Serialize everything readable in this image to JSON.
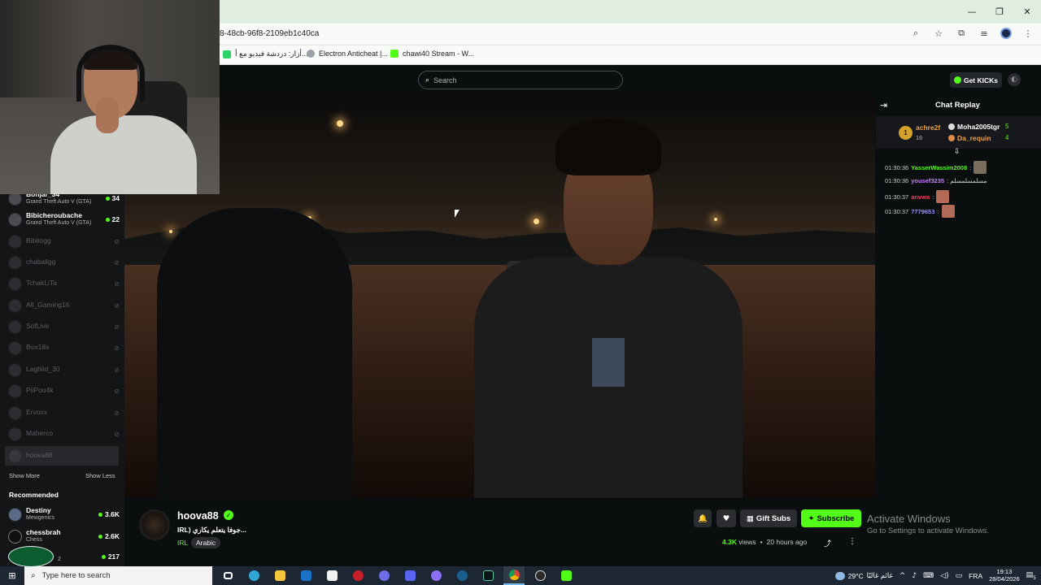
{
  "browser": {
    "url": "8-48cb-96f8-2109eb1c40ca",
    "window_controls": [
      "—",
      "❐",
      "✕"
    ],
    "bookmarks": [
      {
        "label": "أزار: دردشة فيديو مع أ...",
        "color": "#2bd46b"
      },
      {
        "label": "Electron Anticheat |...",
        "color": "#9aa0a6"
      },
      {
        "label": "chawi40 Stream - W...",
        "color": "#53fc18"
      }
    ]
  },
  "header": {
    "search_placeholder": "Search",
    "get_kicks_label": "Get KICKs"
  },
  "sidebar": {
    "following": [
      {
        "name": "Bonjar_34",
        "game": "Grand Theft Auto V (GTA)",
        "count": "34",
        "live": true
      },
      {
        "name": "Bibicheroubache",
        "game": "Grand Theft Auto V (GTA)",
        "count": "22",
        "live": true
      },
      {
        "name": "Bibitogg",
        "live": false
      },
      {
        "name": "chaballgg",
        "live": false
      },
      {
        "name": "TchakLiTa",
        "live": false
      },
      {
        "name": "All_Gaming16",
        "live": false
      },
      {
        "name": "SofLive",
        "live": false
      },
      {
        "name": "Box18x",
        "live": false
      },
      {
        "name": "Laghiid_30",
        "live": false
      },
      {
        "name": "PiiPou4k",
        "live": false
      },
      {
        "name": "Ervoxx",
        "live": false
      },
      {
        "name": "Maherco",
        "live": false
      },
      {
        "name": "hoova88",
        "live": false,
        "active": true
      }
    ],
    "show_more": "Show More",
    "show_less": "Show Less",
    "recommended_title": "Recommended",
    "recommended": [
      {
        "name": "Destiny",
        "game": "Mewgenics",
        "count": "3.6K"
      },
      {
        "name": "chessbrah",
        "game": "Chess",
        "count": "2.6K"
      },
      {
        "name": "",
        "game": "2",
        "count": "217"
      }
    ]
  },
  "chat": {
    "title": "Chat Replay",
    "pinned": {
      "gifter_rank": "1",
      "gifter_name": "achre2f",
      "gifter_count": "16",
      "users": [
        {
          "name": "Moha2005tgr",
          "count": "5"
        },
        {
          "name": "Da_requin",
          "count": "4"
        }
      ]
    },
    "messages": [
      {
        "time": "01:30:36",
        "user": "YasserWassim2008",
        "color": "#53fc18",
        "text": ":"
      },
      {
        "time": "01:30:36",
        "user": "yousef3235",
        "color": "#c77dff",
        "text": ": مسلمسلمسلم"
      },
      {
        "time": "01:30:37",
        "user": "anvwa",
        "color": "#ff3a5a",
        "text": ":"
      },
      {
        "time": "01:30:37",
        "user": "7779653",
        "color": "#9b8cff",
        "text": ":"
      }
    ]
  },
  "channel": {
    "name": "hoova88",
    "title": "IRL) جوفا يتعلم يكاري...",
    "category": "IRL",
    "tag": "Arabic",
    "gift_subs_label": "Gift Subs",
    "subscribe_label": "Subscribe",
    "views": "4.3K",
    "views_label": "views",
    "time_ago": "20 hours ago"
  },
  "watermark": {
    "line1": "Activate Windows",
    "line2": "Go to Settings to activate Windows."
  },
  "taskbar": {
    "search_placeholder": "Type here to search",
    "temperature": "29°C",
    "weather_label": "غائم غالبًا",
    "language": "FRA",
    "time": "19:13",
    "date": "28/04/2026",
    "notification_count": "5"
  }
}
